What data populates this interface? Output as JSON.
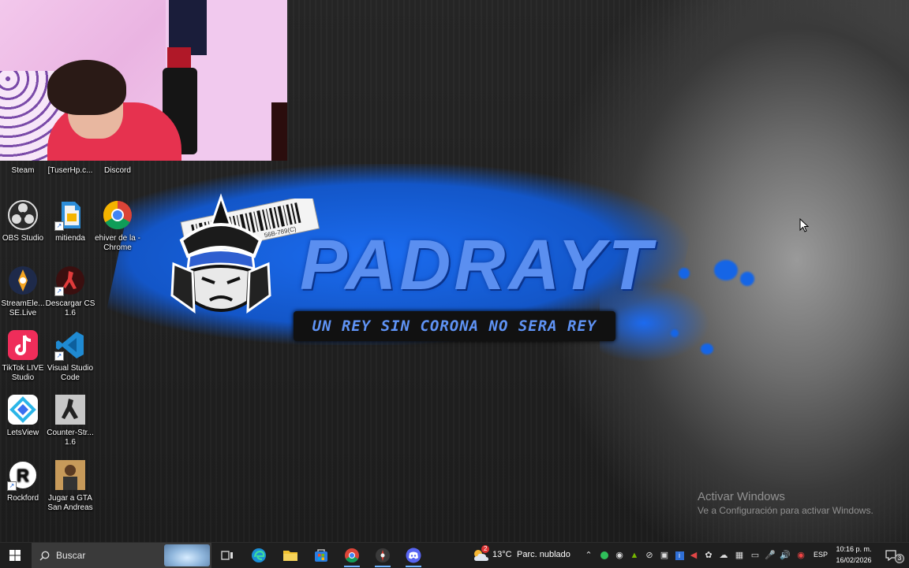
{
  "wallpaper": {
    "brand": "PADRAYT",
    "slogan": "UN REY SIN CORONA NO SERA REY",
    "barcode_text": "56B-789(C)",
    "accent_color": "#1b6cf0"
  },
  "activation": {
    "title": "Activar Windows",
    "subtitle": "Ve a Configuración para activar Windows."
  },
  "desktop_icons": [
    {
      "label": "Steam",
      "icon": "steam-icon"
    },
    {
      "label": "[TuserHp.c...",
      "icon": "file-icon"
    },
    {
      "label": "Discord",
      "icon": "discord-icon"
    },
    {
      "label": "OBS Studio",
      "icon": "obs-icon"
    },
    {
      "label": "mitienda",
      "icon": "document-icon"
    },
    {
      "label": "ehiver de la - Chrome",
      "icon": "chrome-icon"
    },
    {
      "label": "StreamEle... SE.Live",
      "icon": "streamelements-icon"
    },
    {
      "label": "Descargar CS 1.6",
      "icon": "cs-download-icon"
    },
    {
      "label": "TikTok LIVE Studio",
      "icon": "tiktok-icon"
    },
    {
      "label": "Visual Studio Code",
      "icon": "vscode-icon"
    },
    {
      "label": "LetsView",
      "icon": "letsview-icon"
    },
    {
      "label": "Counter-Str... 1.6",
      "icon": "counter-strike-icon"
    },
    {
      "label": "Rockford",
      "icon": "rockford-icon"
    },
    {
      "label": "Jugar a GTA San Andreas",
      "icon": "gta-icon"
    }
  ],
  "taskbar": {
    "search_placeholder": "Buscar",
    "apps": [
      "start-icon",
      "task-view-icon",
      "edge-icon",
      "file-explorer-icon",
      "store-icon",
      "chrome-icon",
      "obs-taskbar-icon",
      "discord-icon"
    ],
    "weather": {
      "temp": "13°C",
      "condition": "Parc. nublado",
      "badge": "2"
    },
    "language": "ESP",
    "time": "10:16 p. m.",
    "date": "16/02/2026",
    "notifications": "3"
  }
}
